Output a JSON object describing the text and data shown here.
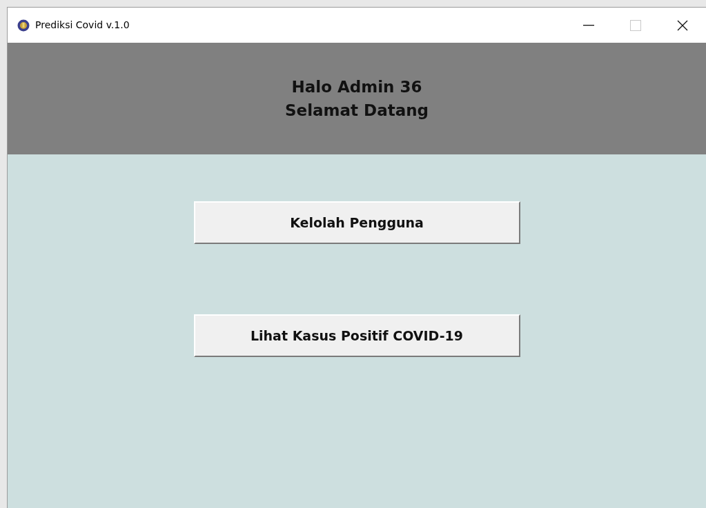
{
  "window": {
    "title": "Prediksi Covid v.1.0",
    "maximize_disabled": true
  },
  "header": {
    "lines": [
      "Halo Admin 36",
      "Selamat Datang"
    ]
  },
  "buttons": [
    {
      "label": "Kelolah Pengguna"
    },
    {
      "label": "Lihat Kasus Positif COVID-19"
    }
  ]
}
